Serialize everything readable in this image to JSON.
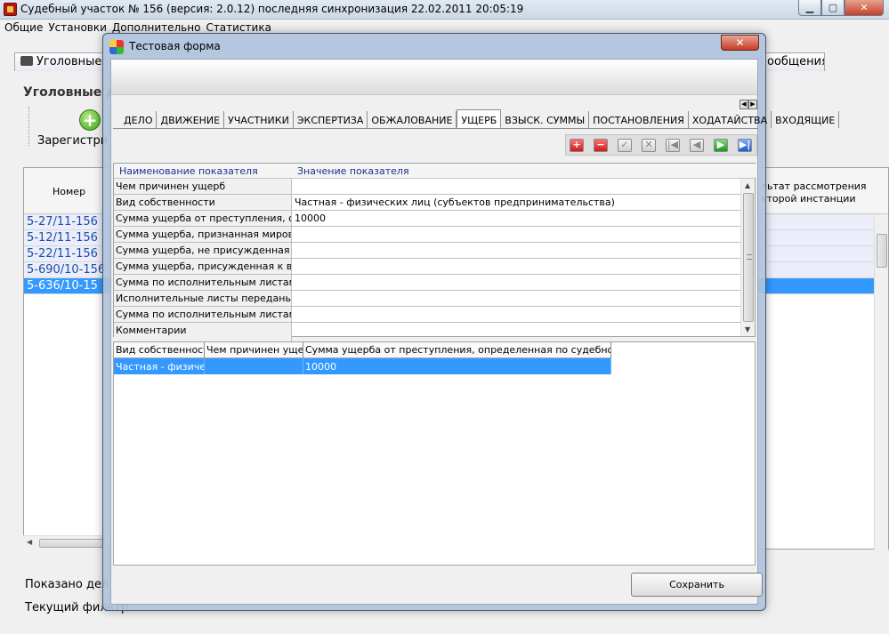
{
  "window": {
    "title": "Судебный участок № 156 (версия: 2.0.12) последняя синхронизация 22.02.2011 20:05:19",
    "minimize": "▁",
    "maximize": "▢",
    "close": "✕"
  },
  "menu": [
    "Общие",
    "Установки",
    "Дополнительно",
    "Статистика"
  ],
  "background": {
    "tab_left": "Уголовные",
    "tab_right": "ообщения",
    "heading": "Уголовные д",
    "register": "Зарегистри",
    "col_number": "Номер",
    "col_result_line1": "льтат рассмотрения",
    "col_result_line2": "второй инстанции",
    "rows": [
      "5-27/11-156",
      "5-12/11-156",
      "5-22/11-156",
      "5-690/10-156",
      "5-636/10-15"
    ],
    "footer_shown": "Показано дел",
    "footer_filter": "Текущий фильтр:"
  },
  "dialog": {
    "title": "Тестовая форма",
    "close": "✕",
    "tabs": [
      "ДЕЛО",
      "ДВИЖЕНИЕ",
      "УЧАСТНИКИ",
      "ЭКСПЕРТИЗА",
      "ОБЖАЛОВАНИЕ",
      "УЩЕРБ",
      "ВЗЫСК. СУММЫ",
      "ПОСТАНОВЛЕНИЯ",
      "ХОДАТАЙСТВА",
      "ВХОДЯЩИЕ"
    ],
    "active_tab": "УЩЕРБ",
    "nav_buttons": {
      "add": "+",
      "delete": "−",
      "confirm": "✓",
      "cancel": "✕",
      "first": "|◀",
      "prev": "◀",
      "next": "▶",
      "last": "▶|"
    },
    "tab_scroll": {
      "left": "◀",
      "right": "▶"
    },
    "prop_headers": {
      "name": "Наименование показателя",
      "value": "Значение показателя"
    },
    "props": [
      {
        "name": "Чем причинен ущерб",
        "value": ""
      },
      {
        "name": "Вид собственности",
        "value": "Частная - физических лиц (субъектов предпринимательства)"
      },
      {
        "name": "Сумма ущерба от преступления, оп...",
        "value": "10000"
      },
      {
        "name": "Сумма ущерба, признанная мировы...",
        "value": ""
      },
      {
        "name": "Сумма ущерба, не присужденная м...",
        "value": ""
      },
      {
        "name": "Сумма ущерба, присужденная к вз...",
        "value": ""
      },
      {
        "name": "Сумма по исполнительным листам, ...",
        "value": ""
      },
      {
        "name": "Исполнительные листы переданы п...",
        "value": ""
      },
      {
        "name": "Сумма по исполнительным листам, ...",
        "value": ""
      },
      {
        "name": "Комментарии",
        "value": ""
      }
    ],
    "list_headers": [
      "Вид собственности",
      "Чем причинен ущерб",
      "Сумма ущерба от преступления, определенная по судебному акту"
    ],
    "list_rows": [
      [
        "Частная - физическ",
        "",
        "10000"
      ]
    ],
    "save": "Сохранить"
  }
}
